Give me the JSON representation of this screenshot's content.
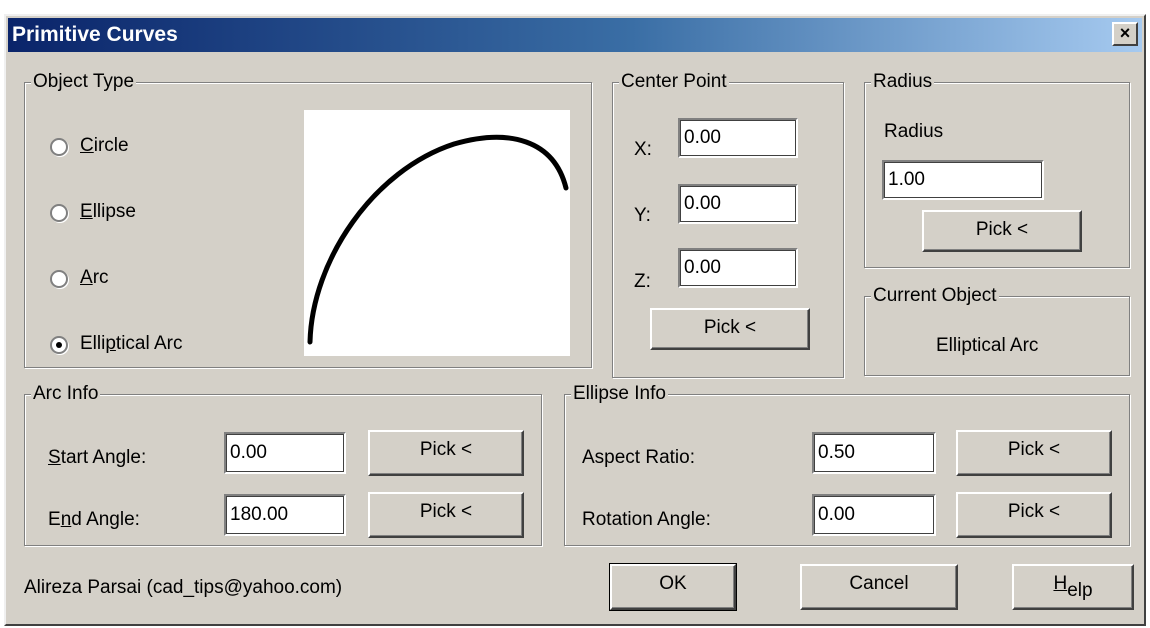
{
  "window": {
    "title": "Primitive Curves",
    "close_label": "×"
  },
  "object_type": {
    "legend": "Object Type",
    "options": [
      {
        "prefix": "",
        "accel": "C",
        "suffix": "ircle",
        "selected": false
      },
      {
        "prefix": "",
        "accel": "E",
        "suffix": "llipse",
        "selected": false
      },
      {
        "prefix": "",
        "accel": "A",
        "suffix": "rc",
        "selected": false
      },
      {
        "prefix": "Elli",
        "accel": "p",
        "suffix": "tical Arc",
        "selected": true
      }
    ]
  },
  "center_point": {
    "legend": "Center Point",
    "x_label": "X:",
    "x_value": "0.00",
    "y_label": "Y:",
    "y_value": "0.00",
    "z_label": "Z:",
    "z_value": "0.00",
    "pick_label": "Pick <"
  },
  "radius": {
    "legend": "Radius",
    "label": "Radius",
    "value": "1.00",
    "pick_label": "Pick <"
  },
  "current_object": {
    "legend": "Current Object",
    "value": "Elliptical Arc"
  },
  "arc_info": {
    "legend": "Arc Info",
    "start_accel": "S",
    "start_rest": "tart Angle:",
    "start_value": "0.00",
    "end_prefix": "E",
    "end_accel": "n",
    "end_rest": "d Angle:",
    "end_value": "180.00",
    "pick_label": "Pick <"
  },
  "ellipse_info": {
    "legend": "Ellipse Info",
    "aspect_label": "Aspect Ratio:",
    "aspect_value": "0.50",
    "rotation_label": "Rotation Angle:",
    "rotation_value": "0.00",
    "pick_label": "Pick <"
  },
  "footer": {
    "credit": "Alireza Parsai (cad_tips@yahoo.com)",
    "ok_label": "OK",
    "cancel_label": "Cancel",
    "help_accel": "H",
    "help_rest": "elp"
  }
}
